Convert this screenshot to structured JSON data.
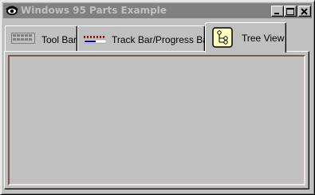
{
  "window": {
    "title": "Windows 95 Parts Example",
    "icon": "eye-icon",
    "controls": {
      "minimize": "minimize-icon",
      "maximize": "maximize-icon",
      "close": "close-icon"
    }
  },
  "tabs": [
    {
      "label": "Tool Bar",
      "icon": "toolbar-icon",
      "selected": false
    },
    {
      "label": "Track Bar/Progress Bar",
      "icon": "trackbar-icon",
      "selected": false
    },
    {
      "label": "Tree View",
      "icon": "treeview-icon",
      "selected": true
    }
  ],
  "colors": {
    "face": "#c0c0c0",
    "inactive_title": "#808080",
    "content_border": "#7a5a58"
  }
}
